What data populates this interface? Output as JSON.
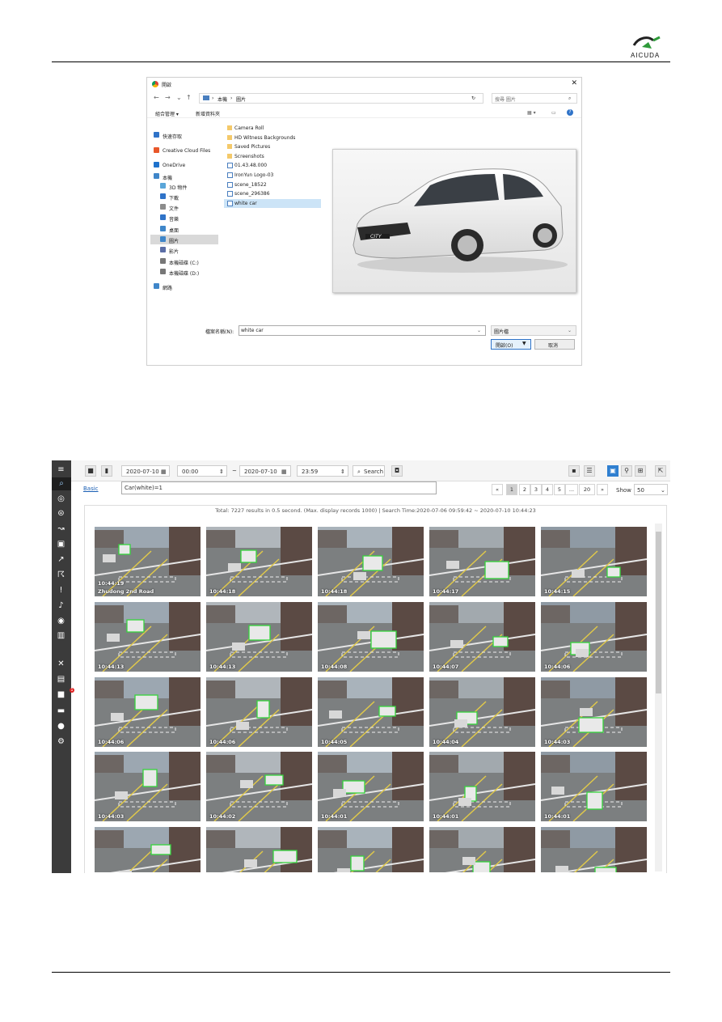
{
  "header": {
    "brand": "AICUDA"
  },
  "dialog": {
    "title": "開啟",
    "path": [
      "本機",
      "圖片"
    ],
    "search_placeholder": "搜尋 圖片",
    "toolbar": {
      "organize": "組合管理 ▾",
      "new_folder": "新增資料夾"
    },
    "nav": [
      {
        "label": "快速存取",
        "icon": "star-icon"
      },
      {
        "label": "Creative Cloud Files",
        "icon": "cloud-icon"
      },
      {
        "label": "OneDrive",
        "icon": "onedrive-icon"
      },
      {
        "label": "本機",
        "icon": "computer-icon"
      },
      {
        "label": "3D 物件",
        "icon": "cube-icon"
      },
      {
        "label": "下載",
        "icon": "download-icon"
      },
      {
        "label": "文件",
        "icon": "document-icon"
      },
      {
        "label": "音樂",
        "icon": "music-icon"
      },
      {
        "label": "桌面",
        "icon": "desktop-icon"
      },
      {
        "label": "圖片",
        "icon": "pictures-icon"
      },
      {
        "label": "影片",
        "icon": "video-icon"
      },
      {
        "label": "本機磁碟 (C:)",
        "icon": "drive-icon"
      },
      {
        "label": "本機磁碟 (D:)",
        "icon": "drive-icon"
      },
      {
        "label": "網路",
        "icon": "network-icon"
      }
    ],
    "files": [
      {
        "label": "Camera Roll",
        "type": "folder"
      },
      {
        "label": "HD Witness Backgrounds",
        "type": "folder"
      },
      {
        "label": "Saved Pictures",
        "type": "folder"
      },
      {
        "label": "Screenshots",
        "type": "folder"
      },
      {
        "label": "01.43.48.000",
        "type": "image"
      },
      {
        "label": "IronYun Logo-03",
        "type": "image"
      },
      {
        "label": "scene_18522",
        "type": "image"
      },
      {
        "label": "scene_296386",
        "type": "image"
      },
      {
        "label": "white car",
        "type": "image"
      }
    ],
    "filename_label": "檔案名稱(N):",
    "filename_value": "white car",
    "filetype_value": "圖片檔",
    "open_button": "開啟(O)",
    "cancel_button": "取消",
    "preview_badge": "CITY"
  },
  "app": {
    "date_from": "2020-07-10",
    "time_from": "00:00",
    "range_sep": "~",
    "date_to": "2020-07-10",
    "time_to": "23:59",
    "search_button": "Search",
    "basic_link": "Basic",
    "query": "Car(white)=1",
    "pages": [
      "«",
      "1",
      "2",
      "3",
      "4",
      "5",
      "...",
      "20",
      "»"
    ],
    "show_label": "Show",
    "show_value": "50",
    "summary": "Total: 7227 results in 0.5 second. (Max. display records 1000) | Search Time:2020-07-06 09:59:42 ~ 2020-07-10 10:44:23",
    "alert_badge": "1",
    "results": [
      {
        "time": "10:44:19",
        "location": "Zhudong 2nd Road"
      },
      {
        "time": "10:44:18",
        "location": ""
      },
      {
        "time": "10:44:18",
        "location": ""
      },
      {
        "time": "10:44:17",
        "location": ""
      },
      {
        "time": "10:44:15",
        "location": ""
      },
      {
        "time": "10:44:13",
        "location": ""
      },
      {
        "time": "10:44:13",
        "location": ""
      },
      {
        "time": "10:44:08",
        "location": ""
      },
      {
        "time": "10:44:07",
        "location": ""
      },
      {
        "time": "10:44:06",
        "location": ""
      },
      {
        "time": "10:44:06",
        "location": ""
      },
      {
        "time": "10:44:06",
        "location": ""
      },
      {
        "time": "10:44:05",
        "location": ""
      },
      {
        "time": "10:44:04",
        "location": ""
      },
      {
        "time": "10:44:03",
        "location": ""
      },
      {
        "time": "10:44:03",
        "location": ""
      },
      {
        "time": "10:44:02",
        "location": ""
      },
      {
        "time": "10:44:01",
        "location": ""
      },
      {
        "time": "10:44:01",
        "location": ""
      },
      {
        "time": "10:44:01",
        "location": ""
      },
      {
        "time": "",
        "location": ""
      },
      {
        "time": "",
        "location": ""
      },
      {
        "time": "",
        "location": ""
      },
      {
        "time": "",
        "location": ""
      },
      {
        "time": "",
        "location": ""
      }
    ]
  }
}
